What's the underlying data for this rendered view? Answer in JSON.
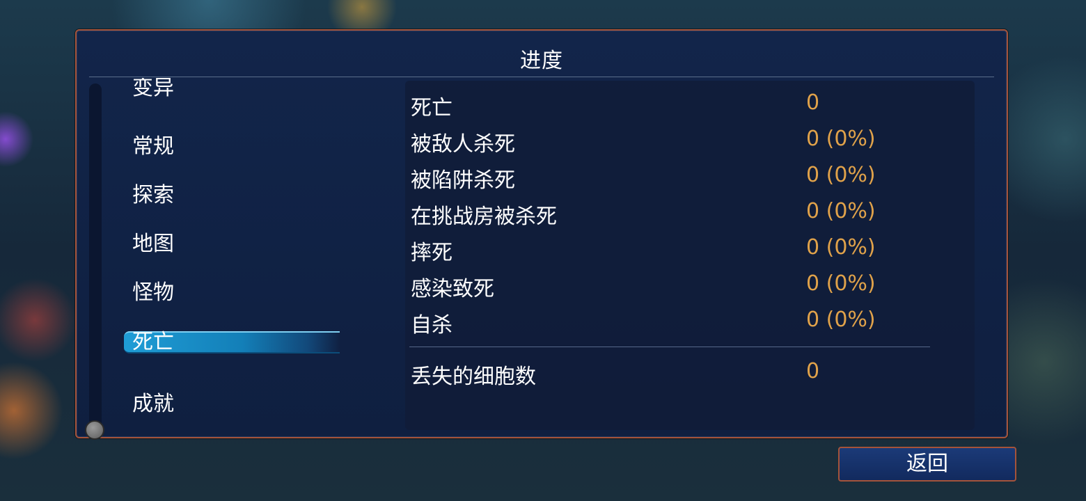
{
  "panel": {
    "title": "进度"
  },
  "sidebar": {
    "items": [
      {
        "label": "变异",
        "active": false
      },
      {
        "label": "常规",
        "active": false
      },
      {
        "label": "探索",
        "active": false
      },
      {
        "label": "地图",
        "active": false
      },
      {
        "label": "怪物",
        "active": false
      },
      {
        "label": "死亡",
        "active": true
      },
      {
        "label": "成就",
        "active": false
      }
    ]
  },
  "stats": {
    "rows": [
      {
        "label": "死亡",
        "value": "0"
      },
      {
        "label": "被敌人杀死",
        "value": "0 (0%)"
      },
      {
        "label": "被陷阱杀死",
        "value": "0 (0%)"
      },
      {
        "label": "在挑战房被杀死",
        "value": "0 (0%)"
      },
      {
        "label": "摔死",
        "value": "0 (0%)"
      },
      {
        "label": "感染致死",
        "value": "0 (0%)"
      },
      {
        "label": "自杀",
        "value": "0 (0%)"
      }
    ],
    "extra": {
      "label": "丢失的细胞数",
      "value": "0"
    }
  },
  "footer": {
    "back_label": "返回"
  },
  "colors": {
    "accent_border": "#a5533a",
    "value_text": "#e0a24a",
    "active_highlight": "#1f9dd6"
  }
}
